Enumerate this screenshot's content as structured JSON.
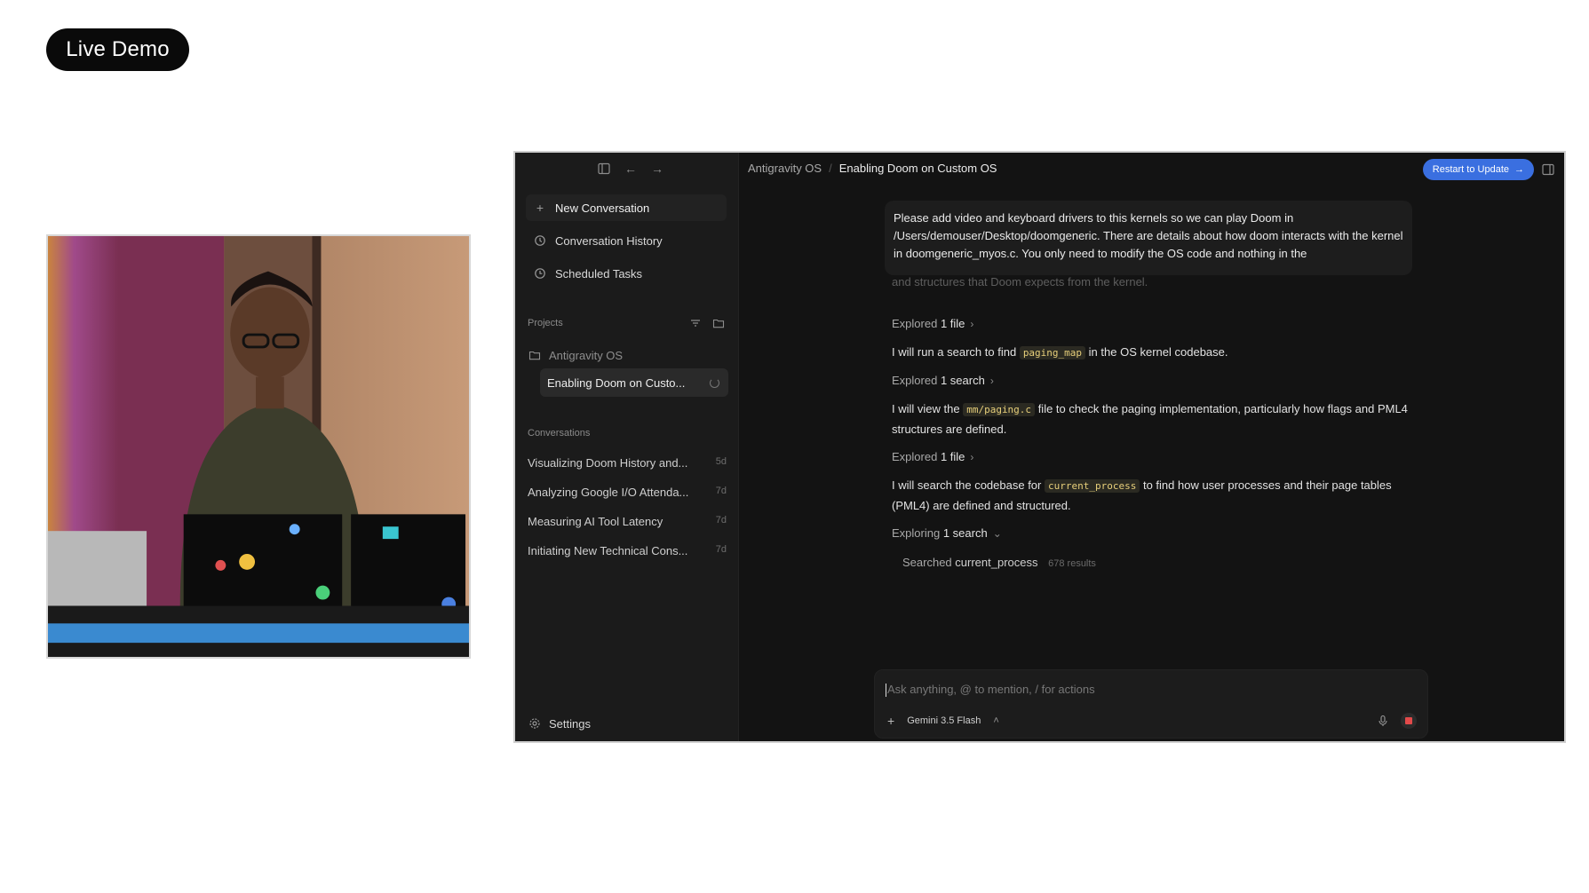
{
  "badge": {
    "label": "Live Demo"
  },
  "app": {
    "sidebar": {
      "nav": [
        {
          "label": "New Conversation",
          "icon": "plus-icon"
        },
        {
          "label": "Conversation History",
          "icon": "history-icon"
        },
        {
          "label": "Scheduled Tasks",
          "icon": "clock-icon"
        }
      ],
      "projects_label": "Projects",
      "project_name": "Antigravity OS",
      "project_item": "Enabling Doom on Custo...",
      "conversations_label": "Conversations",
      "conversations": [
        {
          "title": "Visualizing Doom History and...",
          "age": "5d"
        },
        {
          "title": "Analyzing Google I/O Attenda...",
          "age": "7d"
        },
        {
          "title": "Measuring AI Tool Latency",
          "age": "7d"
        },
        {
          "title": "Initiating New Technical Cons...",
          "age": "7d"
        }
      ],
      "settings": "Settings"
    },
    "header": {
      "crumb1": "Antigravity OS",
      "sep": "/",
      "crumb2": "Enabling Doom on Custom OS",
      "restart": "Restart to Update"
    },
    "chat": {
      "user_message": "Please add video and keyboard drivers to this kernels so we can play Doom in /Users/demouser/Desktop/doomgeneric. There are details about how doom interacts with the kernel in doomgeneric_myos.c. You only need to modify the OS code and nothing in the",
      "faded_line": "and structures that Doom expects from the kernel.",
      "explored1_prefix": "Explored",
      "explored1_value": "1 file",
      "line1_a": "I will run a search to find",
      "line1_code": "paging_map",
      "line1_b": "in the OS kernel codebase.",
      "explored2_prefix": "Explored",
      "explored2_value": "1 search",
      "line2_a": "I will view the",
      "line2_code": "mm/paging.c",
      "line2_b": "file to check the paging implementation, particularly how flags and PML4 structures are defined.",
      "explored3_prefix": "Explored",
      "explored3_value": "1 file",
      "line3_a": "I will search the codebase for",
      "line3_code": "current_process",
      "line3_b": "to find how user processes and their page tables (PML4) are defined and structured.",
      "exploring_prefix": "Exploring",
      "exploring_value": "1 search",
      "searched_prefix": "Searched",
      "searched_value": "current_process",
      "searched_count": "678 results"
    },
    "input": {
      "placeholder": "Ask anything, @ to mention, / for actions",
      "model": "Gemini 3.5 Flash"
    }
  },
  "colors": {
    "accent": "#3a6fe0",
    "stop": "#e24a4a",
    "code": "#e7cf7a"
  }
}
